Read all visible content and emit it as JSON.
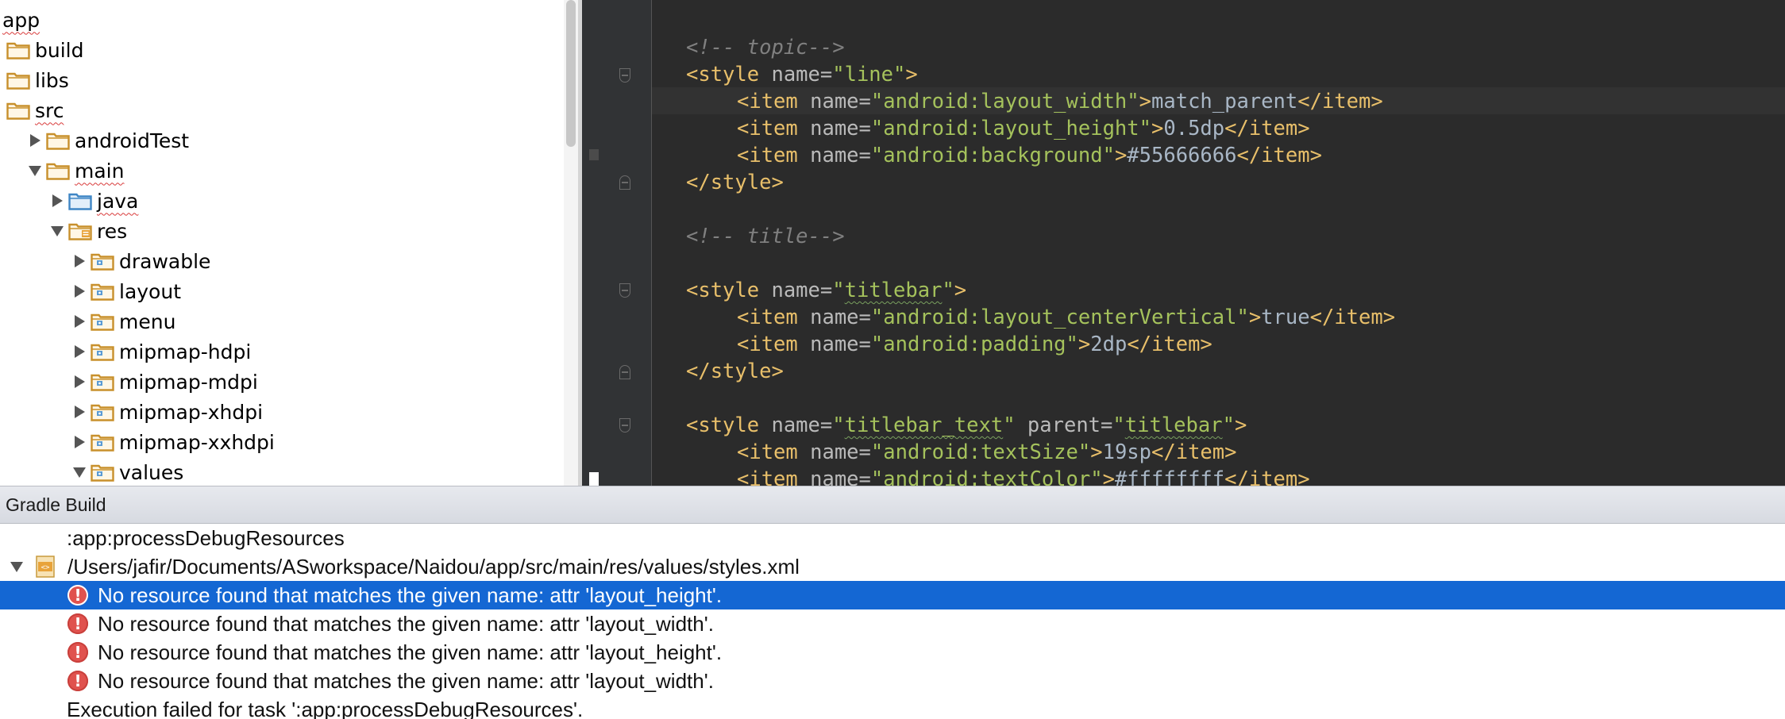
{
  "project_tree": {
    "items": [
      {
        "label": "app",
        "level": 0,
        "expanded": null,
        "folder": "none"
      },
      {
        "label": "build",
        "level": 0,
        "expanded": null,
        "folder": "plain"
      },
      {
        "label": "libs",
        "level": 0,
        "expanded": null,
        "folder": "plain"
      },
      {
        "label": "src",
        "level": 0,
        "expanded": null,
        "folder": "plain"
      },
      {
        "label": "androidTest",
        "level": 1,
        "expanded": false,
        "folder": "plain"
      },
      {
        "label": "main",
        "level": 1,
        "expanded": true,
        "folder": "plain"
      },
      {
        "label": "java",
        "level": 2,
        "expanded": false,
        "folder": "source"
      },
      {
        "label": "res",
        "level": 2,
        "expanded": true,
        "folder": "resources"
      },
      {
        "label": "drawable",
        "level": 3,
        "expanded": false,
        "folder": "res"
      },
      {
        "label": "layout",
        "level": 3,
        "expanded": false,
        "folder": "res"
      },
      {
        "label": "menu",
        "level": 3,
        "expanded": false,
        "folder": "res"
      },
      {
        "label": "mipmap-hdpi",
        "level": 3,
        "expanded": false,
        "folder": "res"
      },
      {
        "label": "mipmap-mdpi",
        "level": 3,
        "expanded": false,
        "folder": "res"
      },
      {
        "label": "mipmap-xhdpi",
        "level": 3,
        "expanded": false,
        "folder": "res"
      },
      {
        "label": "mipmap-xxhdpi",
        "level": 3,
        "expanded": false,
        "folder": "res"
      },
      {
        "label": "values",
        "level": 3,
        "expanded": true,
        "folder": "res"
      }
    ]
  },
  "editor": {
    "comment_topic": "<!-- topic-->",
    "style_line_open": {
      "tag": "<style",
      "attr": " name=",
      "value": "\"line\"",
      "end": ">"
    },
    "item_layout_width": {
      "tag": "<item",
      "attr": " name=",
      "value": "\"android:layout_width\"",
      "gt": ">",
      "text": "match_parent",
      "close": "</item>"
    },
    "item_layout_height": {
      "tag": "<item",
      "attr": " name=",
      "value": "\"android:layout_height\"",
      "gt": ">",
      "text": "0.5dp",
      "close": "</item>"
    },
    "item_background": {
      "tag": "<item",
      "attr": " name=",
      "value": "\"android:background\"",
      "gt": ">",
      "text": "#55666666",
      "close": "</item>"
    },
    "style_close": "</style>",
    "comment_title": "<!-- title-->",
    "style_titlebar_open": {
      "tag": "<style",
      "attr": " name=",
      "q1": "\"",
      "value": "titlebar",
      "q2": "\"",
      "end": ">"
    },
    "item_center_vertical": {
      "tag": "<item",
      "attr": " name=",
      "value": "\"android:layout_centerVertical\"",
      "gt": ">",
      "text": "true",
      "close": "</item>"
    },
    "item_padding": {
      "tag": "<item",
      "attr": " name=",
      "value": "\"android:padding\"",
      "gt": ">",
      "text": "2dp",
      "close": "</item>"
    },
    "style_titlebar_text_open": {
      "tag": "<style",
      "attr": " name=",
      "q1": "\"",
      "value": "titlebar_text",
      "q2": "\"",
      "attr2": " parent=",
      "q3": "\"",
      "value2": "titlebar",
      "q4": "\"",
      "end": ">"
    },
    "item_text_size": {
      "tag": "<item",
      "attr": " name=",
      "value": "\"android:textSize\"",
      "gt": ">",
      "text": "19sp",
      "close": "</item>"
    },
    "item_text_color": {
      "tag": "<item",
      "attr": " name=",
      "value": "\"android:textColor\"",
      "gt": ">",
      "text": "#ffffffff",
      "close": "</item>"
    }
  },
  "gradle": {
    "title": "Gradle Build",
    "task": ":app:processDebugResources",
    "file_path": "/Users/jafir/Documents/ASworkspace/Naidou/app/src/main/res/values/styles.xml",
    "errors": [
      "No resource found that matches the given name: attr 'layout_height'.",
      "No resource found that matches the given name: attr 'layout_width'.",
      "No resource found that matches the given name: attr 'layout_height'.",
      "No resource found that matches the given name: attr 'layout_width'."
    ],
    "error_glyph": "!",
    "execution_failed": "Execution failed for task ':app:processDebugResources'."
  },
  "colors": {
    "editor_background": "#2b2b2b",
    "xml_tag": "#e8bf6a",
    "xml_attr_value": "#a5c25c",
    "selection": "#1467d3",
    "error": "#e0524e"
  }
}
